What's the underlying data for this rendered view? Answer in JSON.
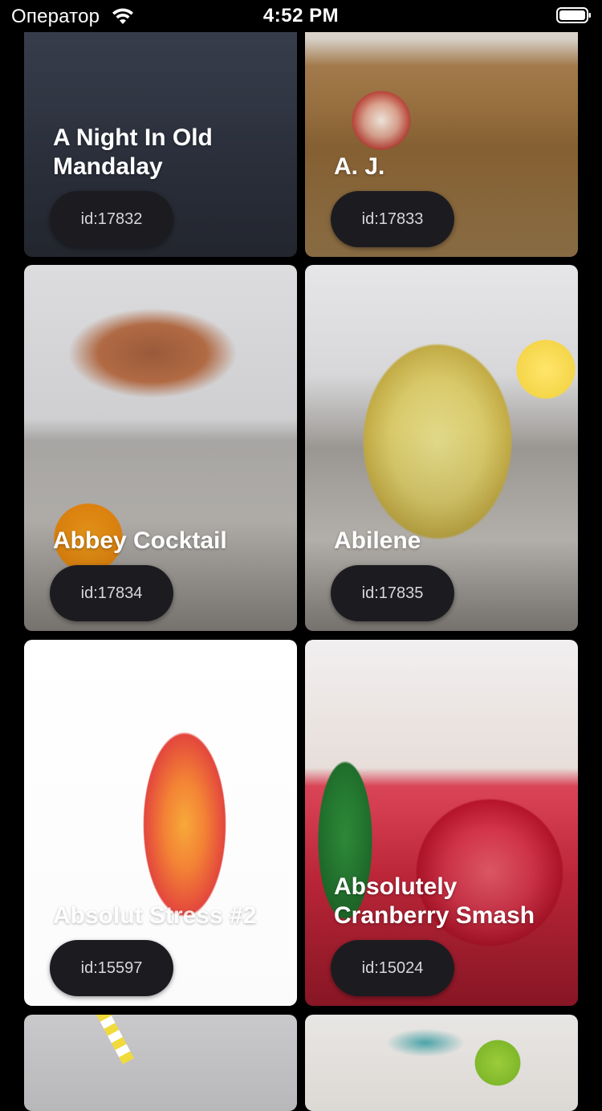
{
  "status_bar": {
    "carrier": "Оператор",
    "time": "4:52 PM",
    "icons": [
      "wifi-icon",
      "battery-icon"
    ]
  },
  "drinks": [
    {
      "name": "A Night In Old Mandalay",
      "id_label": "id:17832"
    },
    {
      "name": "A. J.",
      "id_label": "id:17833"
    },
    {
      "name": "Abbey Cocktail",
      "id_label": "id:17834"
    },
    {
      "name": "Abilene",
      "id_label": "id:17835"
    },
    {
      "name": "Absolut Stress #2",
      "id_label": "id:15597"
    },
    {
      "name": "Absolutely Cranberry Smash",
      "id_label": "id:15024"
    }
  ],
  "colors": {
    "background": "#000000",
    "pill_background": "#1c1c20",
    "pill_text": "#d8d8dc",
    "title_text": "#ffffff"
  }
}
